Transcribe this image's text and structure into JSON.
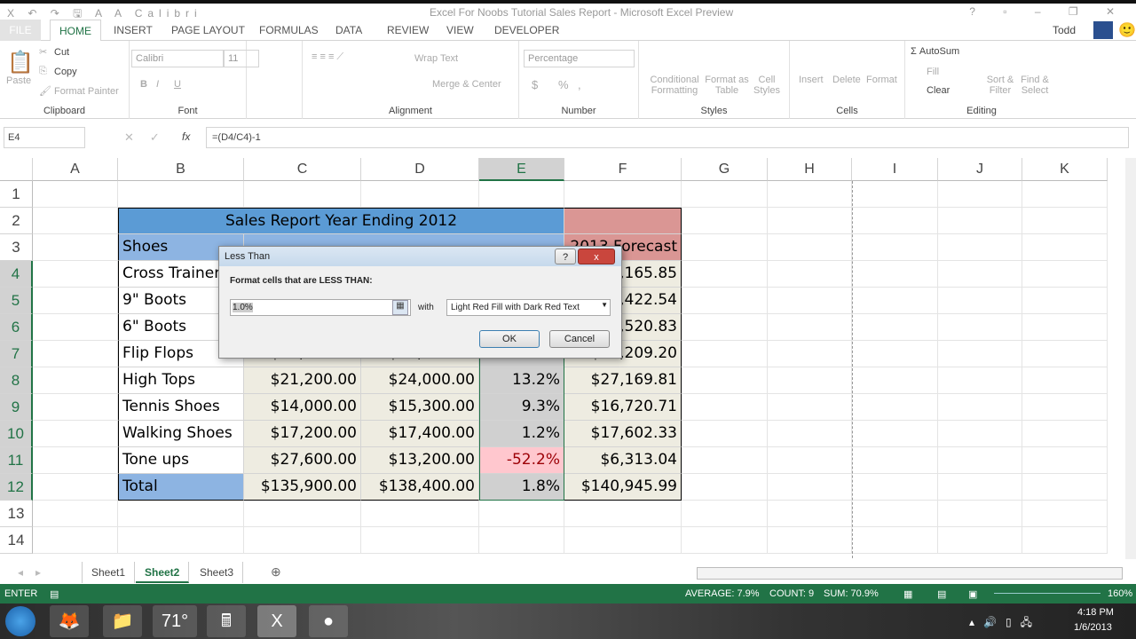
{
  "window": {
    "title": "Excel For Noobs Tutorial Sales Report - Microsoft Excel Preview",
    "qa_font": "Calibri",
    "user": "Todd"
  },
  "tabs": [
    "FILE",
    "HOME",
    "INSERT",
    "PAGE LAYOUT",
    "FORMULAS",
    "DATA",
    "REVIEW",
    "VIEW",
    "DEVELOPER"
  ],
  "ribbon": {
    "clipboard": {
      "label": "Clipboard",
      "paste": "Paste",
      "cut": "Cut",
      "copy": "Copy",
      "format_painter": "Format Painter"
    },
    "font": {
      "label": "Font",
      "name": "Calibri",
      "size": "11",
      "bold": "B",
      "italic": "I",
      "underline": "U"
    },
    "alignment": {
      "label": "Alignment",
      "wrap": "Wrap Text",
      "merge": "Merge & Center"
    },
    "number": {
      "label": "Number",
      "format": "Percentage",
      "currency": "$",
      "percent": "%",
      "comma": ","
    },
    "styles": {
      "label": "Styles",
      "conditional": "Conditional Formatting",
      "format_table": "Format as Table",
      "cell_styles": "Cell Styles"
    },
    "cells": {
      "label": "Cells",
      "insert": "Insert",
      "delete": "Delete",
      "format": "Format"
    },
    "editing": {
      "label": "Editing",
      "autosum": "AutoSum",
      "fill": "Fill",
      "clear": "Clear",
      "sort": "Sort & Filter",
      "find": "Find & Select"
    }
  },
  "formula_bar": {
    "name_box": "E4",
    "fx": "fx",
    "formula": "=(D4/C4)-1"
  },
  "columns": [
    "A",
    "B",
    "C",
    "D",
    "E",
    "F",
    "G",
    "H",
    "I",
    "J",
    "K"
  ],
  "selected_column": "E",
  "rows": [
    "1",
    "2",
    "3",
    "4",
    "5",
    "6",
    "7",
    "8",
    "9",
    "10",
    "11",
    "12",
    "13",
    "14"
  ],
  "sheet": {
    "title": "Sales Report Year Ending 2012",
    "headers": {
      "b": "Shoes",
      "f": "2013 Forecast"
    },
    "data": [
      {
        "b": "Cross Trainers",
        "c": "",
        "d": "",
        "e": "",
        "f": "$19,165.85"
      },
      {
        "b": "9\" Boots",
        "c": "",
        "d": "",
        "e": "",
        "f": "$14,422.54"
      },
      {
        "b": "6\" Boots",
        "c": "",
        "d": "",
        "e": "",
        "f": "$10,520.83"
      },
      {
        "b": "Flip Flops",
        "c": "$17,400.00",
        "d": "$17,800.00",
        "e": "2.3%",
        "f": "$18,209.20"
      },
      {
        "b": "High Tops",
        "c": "$21,200.00",
        "d": "$24,000.00",
        "e": "13.2%",
        "f": "$27,169.81"
      },
      {
        "b": "Tennis Shoes",
        "c": "$14,000.00",
        "d": "$15,300.00",
        "e": "9.3%",
        "f": "$16,720.71"
      },
      {
        "b": "Walking Shoes",
        "c": "$17,200.00",
        "d": "$17,400.00",
        "e": "1.2%",
        "f": "$17,602.33"
      },
      {
        "b": "Tone ups",
        "c": "$27,600.00",
        "d": "$13,200.00",
        "e": "-52.2%",
        "f": "$6,313.04",
        "highlight": true
      },
      {
        "b": "Total",
        "c": "$135,900.00",
        "d": "$138,400.00",
        "e": "1.8%",
        "f": "$140,945.99",
        "total": true
      }
    ]
  },
  "dialog": {
    "title": "Less Than",
    "prompt": "Format cells that are LESS THAN:",
    "value": "1.0%",
    "with": "with",
    "format": "Light Red Fill with Dark Red Text",
    "ok": "OK",
    "cancel": "Cancel",
    "help": "?",
    "close": "x"
  },
  "sheet_tabs": [
    "Sheet1",
    "Sheet2",
    "Sheet3"
  ],
  "active_sheet": "Sheet2",
  "status": {
    "mode": "ENTER",
    "average": "AVERAGE: 7.9%",
    "count": "COUNT: 9",
    "sum": "SUM: 70.9%",
    "zoom": "160%"
  },
  "taskbar": {
    "weather": "71°",
    "time": "4:18 PM",
    "date": "1/6/2013"
  },
  "colors": {
    "excel_green": "#217346",
    "header_blue": "#5b9bd5",
    "light_blue": "#8db4e2",
    "forecast_red": "#da9694",
    "beige": "#eeece1",
    "light_red_fill": "#ffc7ce",
    "dark_red_text": "#9c0006"
  }
}
